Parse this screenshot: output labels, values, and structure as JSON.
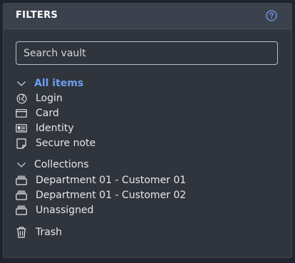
{
  "header": {
    "title": "FILTERS",
    "help_icon": "question-circle-icon"
  },
  "search": {
    "placeholder": "Search vault",
    "value": ""
  },
  "types": {
    "group_label": "All items",
    "expanded": true,
    "items": [
      {
        "label": "Login",
        "icon": "globe-icon"
      },
      {
        "label": "Card",
        "icon": "credit-card-icon"
      },
      {
        "label": "Identity",
        "icon": "id-card-icon"
      },
      {
        "label": "Secure note",
        "icon": "sticky-note-icon"
      }
    ]
  },
  "collections": {
    "group_label": "Collections",
    "expanded": true,
    "items": [
      {
        "label": "Department 01 - Customer 01",
        "icon": "collection-icon"
      },
      {
        "label": "Department 01 - Customer 02",
        "icon": "collection-icon"
      },
      {
        "label": "Unassigned",
        "icon": "collection-icon"
      }
    ]
  },
  "trash": {
    "label": "Trash",
    "icon": "trash-icon"
  },
  "colors": {
    "background": "#1f242e",
    "panel": "#2f343d",
    "header": "#3c424d",
    "accent": "#6f9df1",
    "text": "#e6e8ec"
  }
}
